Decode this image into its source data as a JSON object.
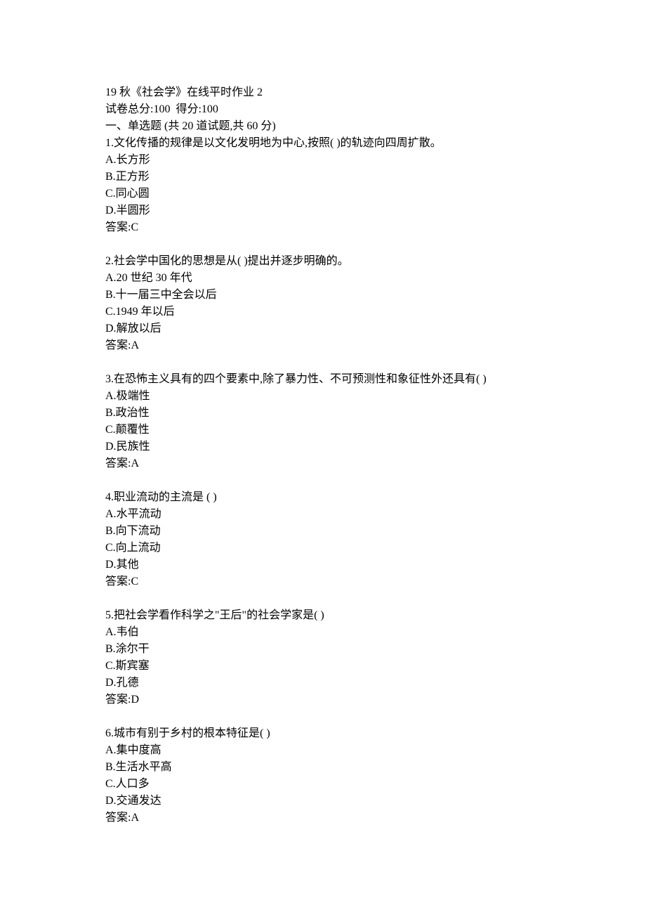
{
  "header": {
    "title": "19 秋《社会学》在线平时作业 2",
    "score_line": "试卷总分:100  得分:100",
    "section": "一、单选题 (共 20 道试题,共 60 分)"
  },
  "questions": [
    {
      "number": "1",
      "text": "文化传播的规律是以文化发明地为中心,按照( )的轨迹向四周扩散。",
      "options": {
        "A": "长方形",
        "B": "正方形",
        "C": "同心圆",
        "D": "半圆形"
      },
      "answer": "C"
    },
    {
      "number": "2",
      "text": "社会学中国化的思想是从( )提出并逐步明确的。",
      "options": {
        "A": "20 世纪 30 年代",
        "B": "十一届三中全会以后",
        "C": "1949 年以后",
        "D": "解放以后"
      },
      "answer": "A"
    },
    {
      "number": "3",
      "text": "在恐怖主义具有的四个要素中,除了暴力性、不可预测性和象征性外还具有( )",
      "options": {
        "A": "极端性",
        "B": "政治性",
        "C": "颠覆性",
        "D": "民族性"
      },
      "answer": "A"
    },
    {
      "number": "4",
      "text": "职业流动的主流是 ( )",
      "options": {
        "A": "水平流动",
        "B": "向下流动",
        "C": "向上流动",
        "D": "其他"
      },
      "answer": "C"
    },
    {
      "number": "5",
      "text": "把社会学看作科学之\"王后\"的社会学家是( )",
      "options": {
        "A": "韦伯",
        "B": "涂尔干",
        "C": "斯宾塞",
        "D": "孔德"
      },
      "answer": "D"
    },
    {
      "number": "6",
      "text": "城市有别于乡村的根本特征是( )",
      "options": {
        "A": "集中度高",
        "B": "生活水平高",
        "C": "人口多",
        "D": "交通发达"
      },
      "answer": "A"
    }
  ],
  "labels": {
    "answer_prefix": "答案:"
  }
}
